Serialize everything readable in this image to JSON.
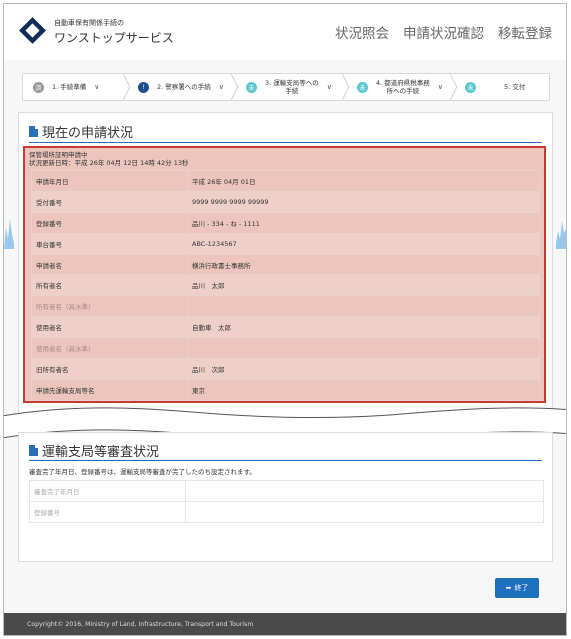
{
  "header": {
    "logo_line1": "自動車保有関係手続の",
    "logo_line2": "ワンストップサービス",
    "nav": [
      "状況照会",
      "申請状況確認",
      "移転登録"
    ]
  },
  "steps": [
    {
      "badge": "済",
      "label": "1. 手続準備",
      "color": "#999999"
    },
    {
      "badge": "!",
      "label": "2. 警察署への手続",
      "color": "#1f4e8c"
    },
    {
      "badge": "未",
      "label": "3. 運輸支局等への\n手続",
      "color": "#5cc6d0"
    },
    {
      "badge": "未",
      "label": "4. 都道府県税事務\n所への手続",
      "color": "#5cc6d0"
    },
    {
      "badge": "未",
      "label": "5. 交付",
      "color": "#5cc6d0"
    }
  ],
  "current": {
    "title": "現在の申請状況",
    "caption_line1": "保管場所証明申請中",
    "caption_line2": "状況更新日時：平成 26年 04月 12日 14時 42分 13秒",
    "rows": [
      {
        "label": "申請年月日",
        "value": "平成 26年 04月 01日"
      },
      {
        "label": "受付番号",
        "value": "9999 9999 9999 99999"
      },
      {
        "label": "登録番号",
        "value": "品川 - 334 - ね - 1111"
      },
      {
        "label": "車台番号",
        "value": "ABC-1234567"
      },
      {
        "label": "申請者名",
        "value": "横浜行政書士事務所"
      },
      {
        "label": "所有者名",
        "value": "品川　太郎"
      },
      {
        "label": "所有者名（高水準）",
        "value": ""
      },
      {
        "label": "使用者名",
        "value": "自動車　太郎"
      },
      {
        "label": "使用者名（高水準）",
        "value": ""
      },
      {
        "label": "旧所有者名",
        "value": "品川　次郎"
      },
      {
        "label": "申請先運輸支局等名",
        "value": "東京"
      }
    ]
  },
  "review": {
    "title": "運輸支局等審査状況",
    "note": "審査完了年月日、登録番号は、運輸支局等審査が完了したのち設定されます。",
    "rows": [
      {
        "label": "審査完了年月日",
        "value": ""
      },
      {
        "label": "登録番号",
        "value": ""
      }
    ]
  },
  "end_button": "終了",
  "footer": "Copyright© 2016, Ministry of Land, Infrastructure, Transport and Tourism",
  "colors": {
    "accent": "#2a6fb5",
    "highlight_border": "#c8392f",
    "highlight_fill": "#ecc6bd",
    "button": "#1f6fbf",
    "footer": "#4a4a4a"
  }
}
